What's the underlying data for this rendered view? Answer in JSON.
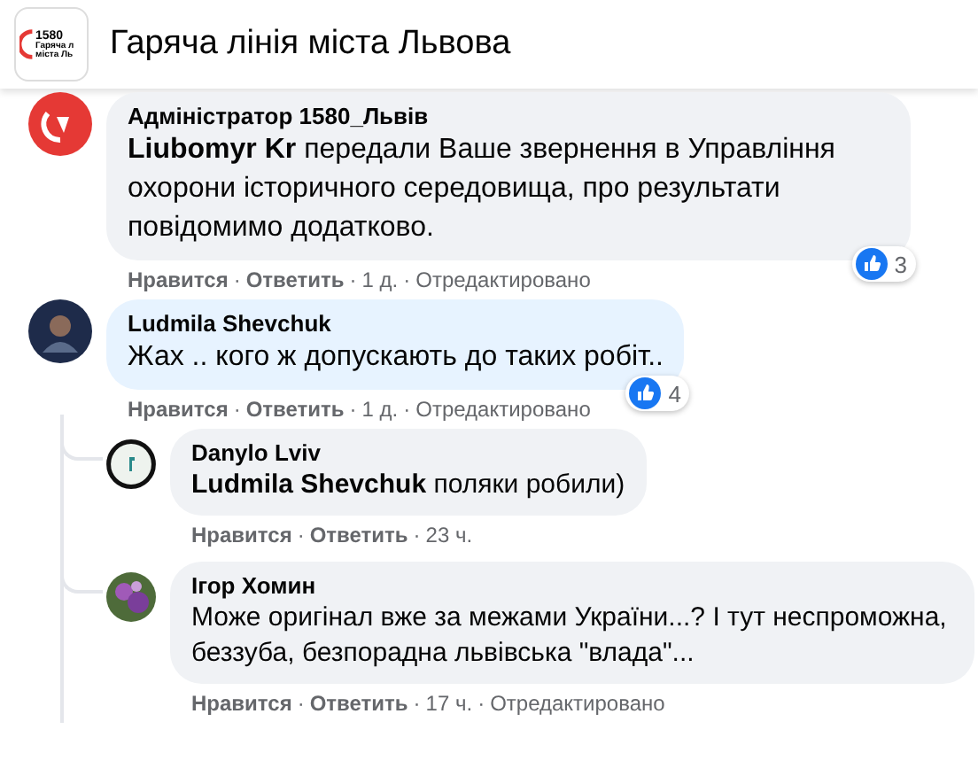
{
  "header": {
    "logo_lines": [
      "1580",
      "Гаряча л",
      "міста Ль"
    ],
    "title": "Гаряча лінія міста Львова"
  },
  "comments": [
    {
      "avatar": {
        "kind": "logo"
      },
      "author": "Адміністратор 1580_Львів",
      "text": "**Liubomyr Kr** передали Ваше звернення в Управління охорони історичного середовища, про результати повідомимо додатково.",
      "reactions": "3",
      "actions": [
        {
          "kind": "link",
          "text": "Нравится"
        },
        {
          "kind": "sep",
          "text": "·"
        },
        {
          "kind": "link",
          "text": "Ответить"
        },
        {
          "kind": "sep",
          "text": "·"
        },
        {
          "kind": "time",
          "text": "1 д."
        },
        {
          "kind": "sep",
          "text": "·"
        },
        {
          "kind": "note",
          "text": "Отредактировано"
        }
      ]
    },
    {
      "avatar": {
        "kind": "person"
      },
      "author": "Ludmila Shevchuk",
      "text": "Жах .. кого ж допускають до таких робіт..",
      "reactions": "4",
      "actions": [
        {
          "kind": "link",
          "text": "Нравится"
        },
        {
          "kind": "sep",
          "text": "·"
        },
        {
          "kind": "link",
          "text": "Ответить"
        },
        {
          "kind": "sep",
          "text": "·"
        },
        {
          "kind": "time",
          "text": "1 д."
        },
        {
          "kind": "sep",
          "text": "·"
        },
        {
          "kind": "note",
          "text": "Отредактировано"
        }
      ],
      "replies": [
        {
          "avatar": {
            "kind": "ring"
          },
          "author": "Danylo Lviv",
          "text": "**Ludmila Shevchuk** поляки робили)",
          "actions": [
            {
              "kind": "link",
              "text": "Нравится"
            },
            {
              "kind": "sep",
              "text": "·"
            },
            {
              "kind": "link",
              "text": "Ответить"
            },
            {
              "kind": "sep",
              "text": "·"
            },
            {
              "kind": "time",
              "text": "23 ч."
            }
          ]
        },
        {
          "avatar": {
            "kind": "flowers"
          },
          "author": "Ігор Хомин",
          "text": "Може оригінал вже за межами України...? І тут неспроможна, беззуба, безпорадна львівська \"влада\"...",
          "actions": [
            {
              "kind": "link",
              "text": "Нравится"
            },
            {
              "kind": "sep",
              "text": "·"
            },
            {
              "kind": "link",
              "text": "Ответить"
            },
            {
              "kind": "sep",
              "text": "·"
            },
            {
              "kind": "time",
              "text": "17 ч."
            },
            {
              "kind": "sep",
              "text": "·"
            },
            {
              "kind": "note",
              "text": "Отредактировано"
            }
          ]
        }
      ]
    }
  ]
}
